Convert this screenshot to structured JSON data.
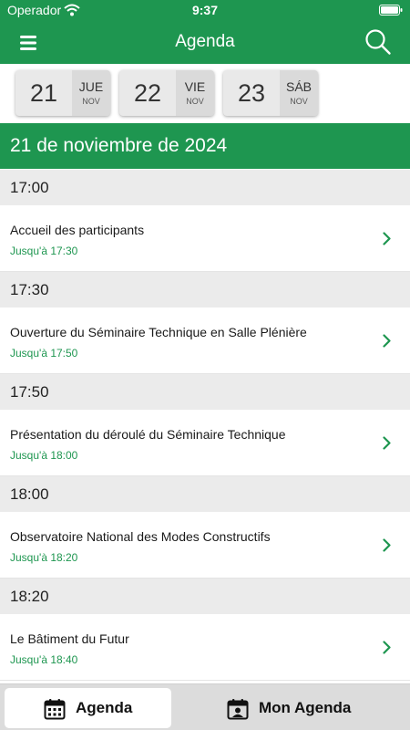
{
  "status": {
    "carrier": "Operador",
    "time": "9:37"
  },
  "nav": {
    "title": "Agenda",
    "menu_icon": "hamburger-menu-icon",
    "search_icon": "search-icon"
  },
  "dates": [
    {
      "day_num": "21",
      "weekday": "JUE",
      "month": "NOV",
      "selected": true
    },
    {
      "day_num": "22",
      "weekday": "VIE",
      "month": "NOV",
      "selected": false
    },
    {
      "day_num": "23",
      "weekday": "SÁB",
      "month": "NOV",
      "selected": false
    }
  ],
  "date_header": "21 de noviembre de 2024",
  "slots": [
    {
      "time": "17:00",
      "title": "Accueil des participants",
      "until": "Jusqu'à 17:30"
    },
    {
      "time": "17:30",
      "title": "Ouverture du Séminaire Technique en Salle Plénière",
      "until": "Jusqu'à 17:50"
    },
    {
      "time": "17:50",
      "title": "Présentation du déroulé du Séminaire Technique",
      "until": "Jusqu'à 18:00"
    },
    {
      "time": "18:00",
      "title": "Observatoire National des Modes Constructifs",
      "until": "Jusqu'à 18:20"
    },
    {
      "time": "18:20",
      "title": "Le Bâtiment du Futur",
      "until": "Jusqu'à 18:40"
    }
  ],
  "tabs": {
    "agenda_label": "Agenda",
    "my_agenda_label": "Mon Agenda"
  },
  "colors": {
    "brand_green": "#1e9650",
    "time_header_bg": "#ebebeb",
    "tab_bar_bg": "#dcdcdc"
  }
}
